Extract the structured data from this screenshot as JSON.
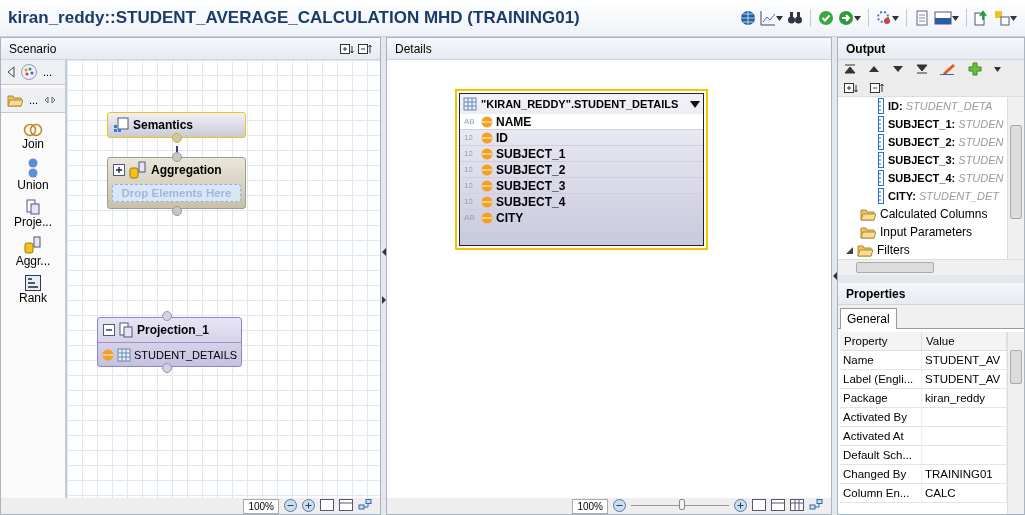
{
  "window": {
    "title": "kiran_reddy::STUDENT_AVERAGE_CALCULATION MHD (TRAINING01)"
  },
  "scenario": {
    "title": "Scenario",
    "palette_more": "...",
    "folder_more": "...",
    "tools": [
      {
        "kind": "join",
        "label": "Join"
      },
      {
        "kind": "union",
        "label": "Union"
      },
      {
        "kind": "projection",
        "label": "Proje..."
      },
      {
        "kind": "aggregation",
        "label": "Aggr..."
      },
      {
        "kind": "rank",
        "label": "Rank"
      }
    ],
    "nodes": [
      {
        "kind": "semantics",
        "title": "Semantics",
        "selected": true
      },
      {
        "kind": "aggregation",
        "title": "Aggregation",
        "selected": false,
        "expanded": false,
        "drop_hint": "Drop Elements Here"
      },
      {
        "kind": "projection",
        "title": "Projection_1",
        "selected": false,
        "expanded": true,
        "inputs": [
          "STUDENT_DETAILS"
        ]
      }
    ],
    "zoom": "100%"
  },
  "details": {
    "title": "Details",
    "table": {
      "title": "\"KIRAN_REDDY\".STUDENT_DETAILS",
      "columns": [
        {
          "type": "AB",
          "name": "NAME",
          "selected": true
        },
        {
          "type": "12",
          "name": "ID",
          "selected": false
        },
        {
          "type": "12",
          "name": "SUBJECT_1",
          "selected": false
        },
        {
          "type": "12",
          "name": "SUBJECT_2",
          "selected": false
        },
        {
          "type": "12",
          "name": "SUBJECT_3",
          "selected": false
        },
        {
          "type": "12",
          "name": "SUBJECT_4",
          "selected": false
        },
        {
          "type": "AB",
          "name": "CITY",
          "selected": false
        }
      ]
    },
    "zoom": "100%",
    "slider": {
      "level": 0.52
    }
  },
  "output": {
    "title": "Output",
    "columns": [
      {
        "name": "ID:",
        "source": "STUDENT_DETA"
      },
      {
        "name": "SUBJECT_1:",
        "source": "STUDEN"
      },
      {
        "name": "SUBJECT_2:",
        "source": "STUDEN"
      },
      {
        "name": "SUBJECT_3:",
        "source": "STUDEN"
      },
      {
        "name": "SUBJECT_4:",
        "source": "STUDEN"
      },
      {
        "name": "CITY:",
        "source": "STUDENT_DET"
      }
    ],
    "folders": [
      {
        "label": "Calculated Columns",
        "expandable": false
      },
      {
        "label": "Input Parameters",
        "expandable": false
      },
      {
        "label": "Filters",
        "expandable": true
      }
    ]
  },
  "properties": {
    "title": "Properties",
    "tabs": [
      {
        "label": "General",
        "selected": true
      }
    ],
    "columns": [
      "Property",
      "Value"
    ],
    "rows": [
      {
        "property": "Name",
        "value": "STUDENT_AV"
      },
      {
        "property": "Label (Engli...",
        "value": "STUDENT_AV"
      },
      {
        "property": "Package",
        "value": "kiran_reddy"
      },
      {
        "property": "Activated By"
      },
      {
        "property": "Activated At"
      },
      {
        "property": "Default Sch..."
      },
      {
        "property": "Changed By",
        "value": "TRAINING01"
      },
      {
        "property": "Column En...",
        "value": "CALC"
      }
    ]
  }
}
